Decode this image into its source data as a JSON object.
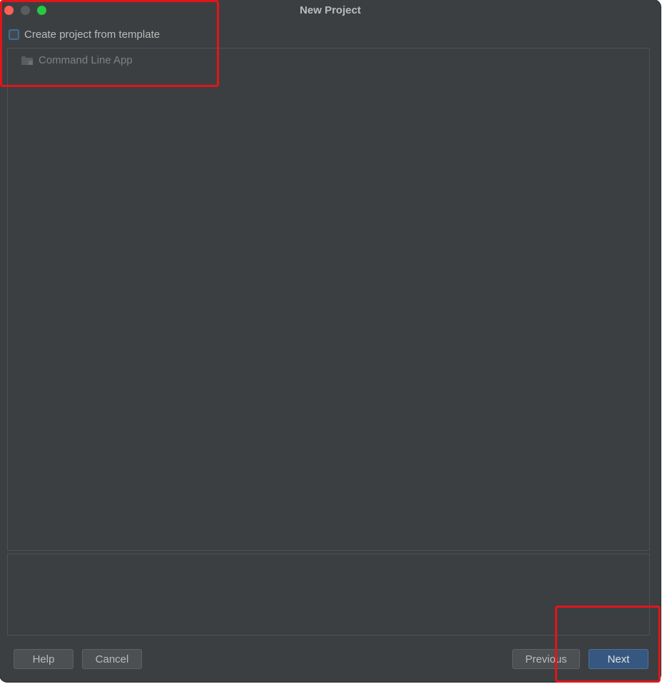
{
  "window": {
    "title": "New Project"
  },
  "template_option": {
    "label": "Create project from template",
    "checked": false
  },
  "template_list": {
    "items": [
      {
        "label": "Command Line App",
        "icon": "folder-icon"
      }
    ]
  },
  "buttons": {
    "help": "Help",
    "cancel": "Cancel",
    "previous": "Previous",
    "next": "Next"
  },
  "colors": {
    "background": "#3c3f41",
    "accent": "#365880",
    "highlight": "#e0161b"
  }
}
